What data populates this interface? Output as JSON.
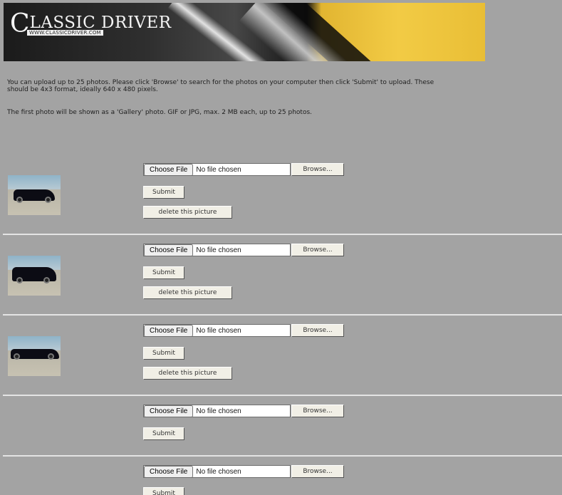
{
  "banner": {
    "logo_big_letter": "C",
    "logo_text": "LASSIC DRIVER",
    "logo_url": "WWW.CLASSICDRIVER.COM"
  },
  "intro": {
    "line1": "You can upload up to 25 photos. Please click 'Browse' to search for the photos on your computer then click 'Submit' to upload. These\nshould be 4x3 format, ideally 640 x 480 pixels.",
    "line2": "The first photo will be shown as a 'Gallery' photo. GIF or JPG, max. 2 MB each, up to 25 photos."
  },
  "labels": {
    "browse": "Browse...",
    "submit": "Submit",
    "delete": "delete this picture"
  },
  "rows": [
    {
      "file_value": "",
      "has_photo": true
    },
    {
      "file_value": "",
      "has_photo": true
    },
    {
      "file_value": "",
      "has_photo": true
    },
    {
      "file_value": "",
      "has_photo": false
    },
    {
      "file_value": "",
      "has_photo": false
    }
  ]
}
